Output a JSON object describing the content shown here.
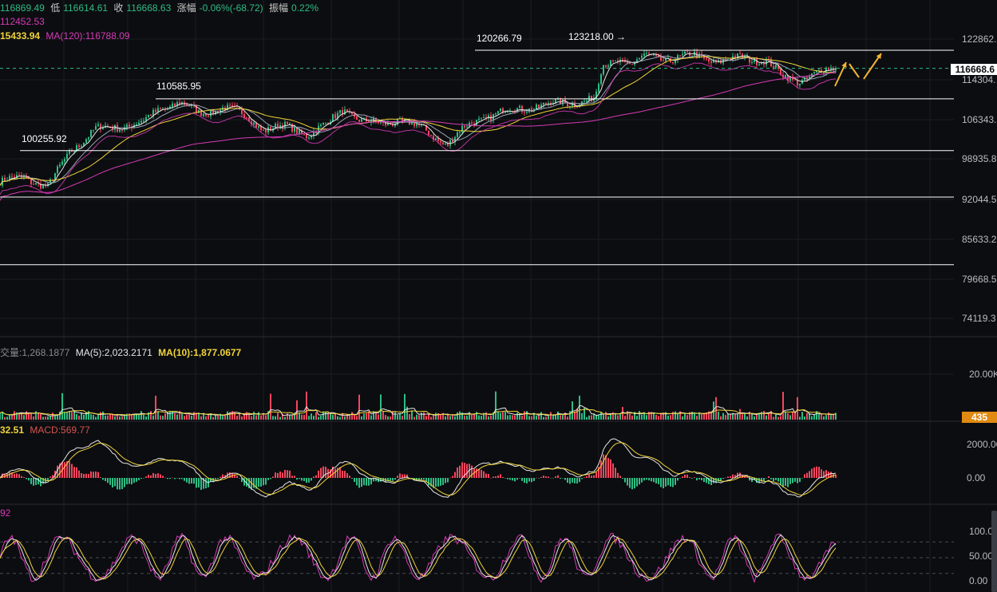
{
  "header": {
    "ohlc": [
      {
        "label": "",
        "value": "116869.49",
        "color": "#2ebd85"
      },
      {
        "label": "低",
        "value": "116614.61",
        "color": "#2ebd85"
      },
      {
        "label": "收",
        "value": "116668.63",
        "color": "#2ebd85"
      },
      {
        "label": "涨幅",
        "value": "-0.06%(-68.72)",
        "color": "#2ebd85"
      },
      {
        "label": "振幅",
        "value": "0.22%",
        "color": "#2ebd85"
      }
    ],
    "ma_line1": "112452.53",
    "ma_line2_a": "15433.94",
    "ma_line2_b": "MA(120):116788.09"
  },
  "volume_header": {
    "vol": "交量:1,268.1877",
    "ma5": "MA(5):2,023.2171",
    "ma10": "MA(10):1,877.0677"
  },
  "macd_header": {
    "dif": "32.51",
    "macd": "MACD:569.77"
  },
  "kdj_header": {
    "label": "92"
  },
  "current_price_tag": "116668.6",
  "volume_tag": "435",
  "colors": {
    "up": "#2ebd85",
    "down": "#f6465d",
    "ma_white": "#e6e6e6",
    "ma_yellow": "#f0d43a",
    "ma_magenta": "#d63bb8",
    "arrow": "#f3b532",
    "price_tag_bg": "#ffffff",
    "vol_tag_bg": "#e08a12"
  },
  "chart_data": {
    "type": "candlestick",
    "price_axis_ticks": [
      "122862.",
      "114304.",
      "106343.",
      "98935.8",
      "92044.5",
      "85633.2",
      "79668.5",
      "74119.3"
    ],
    "price_axis_values": [
      122862,
      114304,
      106343,
      98935.8,
      92044.5,
      85633.2,
      79668.5,
      74119.3
    ],
    "volume_axis_ticks": [
      "20.00K"
    ],
    "macd_axis_ticks": [
      "2000.00",
      "0.00"
    ],
    "kdj_axis_ticks": [
      "100.00",
      "50.00",
      "0.00"
    ],
    "annotations": [
      {
        "text": "120266.79",
        "value": 120266.79
      },
      {
        "text": "123218.00 →",
        "value": 123218.0
      },
      {
        "text": "110585.95",
        "value": 110585.95
      },
      {
        "text": "100255.92",
        "value": 100255.92
      }
    ],
    "horizontal_levels": [
      120266.79,
      110585.95,
      100255.92,
      91000,
      77500
    ],
    "close_keypoints": [
      [
        0,
        94000
      ],
      [
        30,
        95000
      ],
      [
        60,
        93000
      ],
      [
        90,
        100500
      ],
      [
        120,
        104500
      ],
      [
        150,
        105000
      ],
      [
        180,
        106000
      ],
      [
        200,
        108500
      ],
      [
        225,
        110000
      ],
      [
        250,
        107500
      ],
      [
        280,
        109000
      ],
      [
        310,
        107000
      ],
      [
        330,
        104500
      ],
      [
        360,
        105000
      ],
      [
        385,
        103500
      ],
      [
        410,
        105500
      ],
      [
        430,
        108500
      ],
      [
        455,
        106000
      ],
      [
        480,
        105500
      ],
      [
        500,
        106500
      ],
      [
        530,
        104500
      ],
      [
        560,
        101500
      ],
      [
        580,
        104500
      ],
      [
        600,
        106500
      ],
      [
        630,
        108000
      ],
      [
        660,
        108800
      ],
      [
        690,
        109500
      ],
      [
        720,
        110000
      ],
      [
        745,
        110500
      ],
      [
        755,
        117000
      ],
      [
        775,
        118500
      ],
      [
        790,
        117500
      ],
      [
        810,
        119000
      ],
      [
        840,
        118500
      ],
      [
        870,
        119200
      ],
      [
        900,
        118000
      ],
      [
        930,
        118800
      ],
      [
        960,
        118300
      ],
      [
        980,
        115000
      ],
      [
        1000,
        114200
      ],
      [
        1020,
        115500
      ],
      [
        1047,
        116668
      ]
    ],
    "last_price": 116668.63
  }
}
